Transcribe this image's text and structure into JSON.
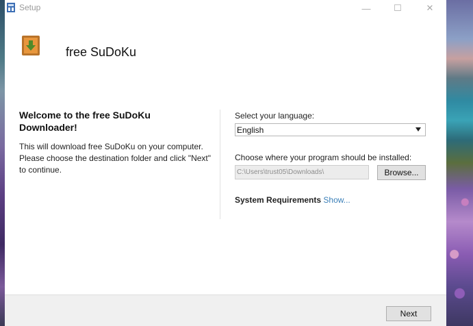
{
  "window": {
    "title": "Setup",
    "controls": {
      "minimize": "—",
      "maximize": "☐",
      "close": "✕"
    }
  },
  "header": {
    "app_name": "free SuDoKu",
    "icon": "download-package-icon"
  },
  "welcome": {
    "title": "Welcome to the free SuDoKu Downloader!",
    "body": "This will download free SuDoKu on your computer. Please choose the destination folder and click \"Next\" to continue."
  },
  "language": {
    "label": "Select your language:",
    "selected": "English"
  },
  "install": {
    "label": "Choose where your program should be installed:",
    "path": "C:\\Users\\trust05\\Downloads\\",
    "browse_label": "Browse..."
  },
  "system_requirements": {
    "label": "System Requirements",
    "link": "Show..."
  },
  "footer": {
    "next_label": "Next"
  },
  "colors": {
    "link": "#3a7fb8",
    "footer_bg": "#f0f0f0",
    "button_bg": "#e1e1e1"
  }
}
